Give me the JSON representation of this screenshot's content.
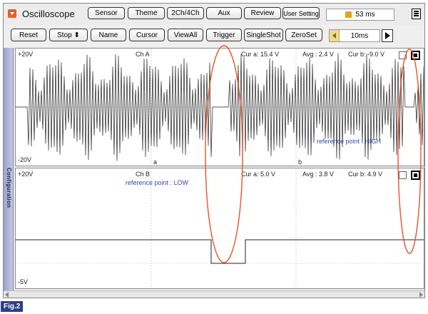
{
  "app": {
    "title": "Oscilloscope"
  },
  "top_buttons": [
    {
      "label": "Sensor"
    },
    {
      "label": "Theme"
    },
    {
      "label": "2Ch/4Ch"
    },
    {
      "label": "Aux"
    },
    {
      "label": "Review"
    },
    {
      "label": "User Setting"
    }
  ],
  "time_display": {
    "value": "53 ms"
  },
  "toolbar": [
    {
      "label": "Reset"
    },
    {
      "label": "Stop ⬍"
    },
    {
      "label": "Name"
    },
    {
      "label": "Cursor"
    },
    {
      "label": "ViewAll"
    },
    {
      "label": "Trigger"
    },
    {
      "label": "SingleShot"
    },
    {
      "label": "ZeroSet"
    }
  ],
  "timebase": {
    "value": "10ms"
  },
  "side_tab": {
    "label": "Configuration"
  },
  "channel_a": {
    "name": "Ch A",
    "top_label": "+20V",
    "bottom_label": "-20V",
    "cur_a": "Cur a: 15.4 V",
    "avg": "Avg : 2.4 V",
    "cur_b": "Cur b: -9.0 V",
    "cursor_a_marker": "a",
    "cursor_b_marker": "b",
    "reference": "reference point : HIGH"
  },
  "channel_b": {
    "name": "Ch B",
    "top_label": "+20V",
    "bottom_label": "-5V",
    "cur_a": "Cur a: 5.0 V",
    "avg": "Avg : 3.8 V",
    "cur_b": "Cur b: 4.9 V",
    "reference": "reference point : LOW"
  },
  "figure_label": "Fig.2",
  "colors": {
    "annotation": "#e8552a",
    "reference_text": "#3a46a8",
    "fig_badge": "#2f3d8a"
  }
}
